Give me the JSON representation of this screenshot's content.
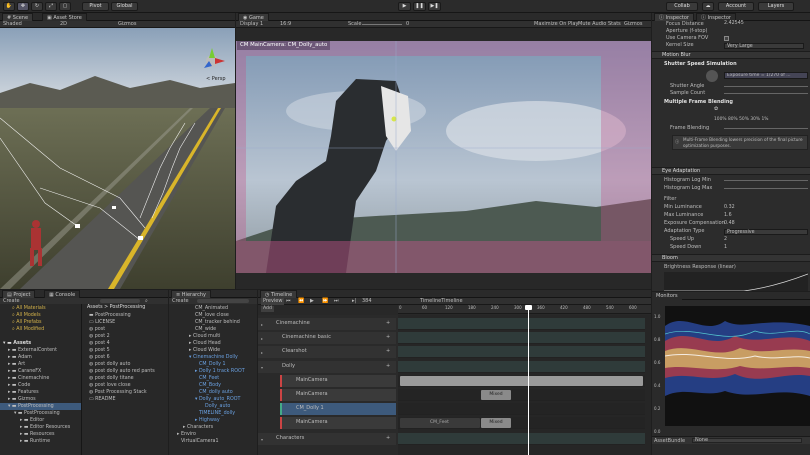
{
  "toolbar": {
    "pivot": "Pivot",
    "global": "Global",
    "collab": "Collab",
    "account": "Account",
    "layers": "Layers"
  },
  "scene": {
    "tab_scene": "Scene",
    "tab_asset_store": "Asset Store",
    "shaded": "Shaded",
    "mode_2d": "2D",
    "gizmos": "Gizmos",
    "persp": "< Persp"
  },
  "game": {
    "tab": "Game",
    "display": "Display 1",
    "aspect": "16:9",
    "scale_label": "Scale",
    "scale_value": "0",
    "maximize": "Maximize On Play",
    "mute": "Mute Audio",
    "stats": "Stats",
    "gizmos": "Gizmos",
    "camera_label": "CM MainCamera: CM_Dolly_auto"
  },
  "project": {
    "tab_project": "Project",
    "tab_console": "Console",
    "create": "Create",
    "favorites": [
      "All Materials",
      "All Models",
      "All Prefabs",
      "All Modified"
    ],
    "assets_header": "Assets",
    "folders": [
      "ExternalContent",
      "Adam",
      "Art",
      "CaraneFX",
      "Cinemachine",
      "Code",
      "Features",
      "Gizmos",
      "PostProcessing",
      "PostProcessing",
      "Editor",
      "Editor Resources",
      "Resources",
      "Runtime"
    ],
    "breadcrumb": "Assets > PostProcessing",
    "files": [
      "PostProcessing",
      "LICENSE",
      "post",
      "post 2",
      "post 4",
      "post 5",
      "post 6",
      "post dolly auto",
      "post dolly auto red pants",
      "post dolly titane",
      "post love close",
      "Post Processing Stack",
      "README"
    ]
  },
  "hierarchy": {
    "tab": "Hierarchy",
    "create": "Create",
    "items": [
      "CM_Animated",
      "CM_love close",
      "CM_tracker behind",
      "CM_wide",
      "Cloud multi",
      "Cloud Head",
      "Cloud Wide",
      "Cinemachine Dolly",
      "CM_Dolly 1",
      "Dolly 1 track ROOT",
      "CM_Feet",
      "CM_Body",
      "CM_dolly auto",
      "Dolly_auto_ROOT",
      "Dolly_auto",
      "TIMELINE_dolly",
      "Highway",
      "Characters",
      "Enviro",
      "VirtualCamera1"
    ]
  },
  "timeline": {
    "tab": "Timeline",
    "preview": "Preview",
    "frame": "384",
    "asset_name": "TimelineTimeline",
    "add": "Add",
    "ruler": [
      "0",
      "60",
      "120",
      "180",
      "240",
      "300",
      "360",
      "420",
      "480",
      "540",
      "600"
    ],
    "groups": [
      "Cinemachine",
      "Cinemachine basic",
      "Clearshot",
      "Dolly",
      "Characters"
    ],
    "tracks": [
      "MainCamera",
      "MainCamera",
      "CM_Dolly 1",
      "MainCamera"
    ],
    "clips": {
      "mixed": "Mixed",
      "cm_feet": "CM_Feet"
    }
  },
  "inspector": {
    "tab_inspector": "Inspector",
    "tab_inspector2": "Inspector",
    "top_props": [
      {
        "label": "Focus Distance",
        "value": "2.42545"
      },
      {
        "label": "Aperture (f-stop)",
        "value": ""
      },
      {
        "label": "Use Camera FOV",
        "value": ""
      },
      {
        "label": "Kernel Size",
        "value": "Very Large"
      }
    ],
    "motion_blur": {
      "title": "Motion Blur",
      "shutter_title": "Shutter Speed Simulation",
      "shutter_value": "Exposure time = 1/270 of ...",
      "shutter_angle": "Shutter Angle",
      "sample_count": "Sample Count",
      "frame_title": "Multiple Frame Blending",
      "percents": [
        "100%",
        "80%",
        "50%",
        "30%",
        "1%"
      ],
      "frame_blending": "Frame Blending",
      "help": "Multi-Frame Blending lowers precision of the final picture optimization purposes."
    },
    "eye": {
      "title": "Eye Adaptation",
      "props": [
        {
          "label": "Histogram Log Min",
          "value": ""
        },
        {
          "label": "Histogram Log Max",
          "value": ""
        },
        {
          "label": "Filter",
          "value": ""
        },
        {
          "label": "Min Luminance",
          "value": "0.32"
        },
        {
          "label": "Max Luminance",
          "value": "1.6"
        },
        {
          "label": "Exposure Compensation",
          "value": "0.48"
        },
        {
          "label": "Adaptation Type",
          "value": "Progressive"
        },
        {
          "label": "Speed Up",
          "value": "2"
        },
        {
          "label": "Speed Down",
          "value": "1"
        }
      ]
    },
    "bloom": {
      "title": "Bloom",
      "response": "Brightness Response (linear)"
    }
  },
  "monitors": {
    "tab": "Monitors",
    "axis": [
      "1.0",
      "0.8",
      "0.6",
      "0.4",
      "0.2",
      "0.0"
    ],
    "asset_bundle": "AssetBundle",
    "none": "None"
  },
  "colors": {
    "accent": "#3d5a7c",
    "timeline_bar": "#3f4e4c",
    "camera_overlay": "#c4548a"
  }
}
